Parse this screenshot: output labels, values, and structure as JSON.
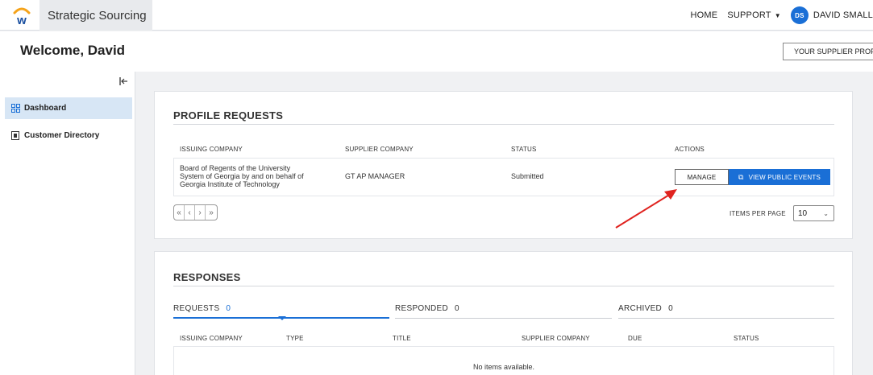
{
  "header": {
    "app_title": "Strategic Sourcing",
    "nav": {
      "home": "HOME",
      "support": "SUPPORT",
      "user_initials": "DS",
      "user_name": "DAVID SMALL"
    },
    "brand_color": "#1a6fd6",
    "logo_letter": "w"
  },
  "welcome": {
    "title": "Welcome, David",
    "supplier_profile_button": "YOUR SUPPLIER PROFILE"
  },
  "sidebar": {
    "collapse_icon": "collapse-left-icon",
    "items": [
      {
        "label": "Dashboard",
        "icon": "dashboard-icon",
        "active": true
      },
      {
        "label": "Customer Directory",
        "icon": "directory-icon",
        "active": false
      }
    ]
  },
  "profile_requests": {
    "title": "PROFILE REQUESTS",
    "columns": [
      "ISSUING COMPANY",
      "SUPPLIER COMPANY",
      "STATUS",
      "ACTIONS"
    ],
    "rows": [
      {
        "issuing_company_lines": [
          "Board of Regents of the University",
          "System of Georgia by and on behalf of",
          "Georgia Institute of Technology"
        ],
        "supplier_company": "GT AP MANAGER",
        "status": "Submitted",
        "actions": {
          "manage": "MANAGE",
          "view_public_events": "VIEW PUBLIC EVENTS"
        }
      }
    ],
    "pagination": {
      "first": "«",
      "prev": "‹",
      "next": "›",
      "last": "»"
    },
    "items_per_page_label": "ITEMS PER PAGE",
    "items_per_page_value": "10"
  },
  "responses": {
    "title": "RESPONSES",
    "tabs": [
      {
        "label": "REQUESTS",
        "count": "0",
        "active": true
      },
      {
        "label": "RESPONDED",
        "count": "0",
        "active": false
      },
      {
        "label": "ARCHIVED",
        "count": "0",
        "active": false
      }
    ],
    "columns": [
      "ISSUING COMPANY",
      "TYPE",
      "TITLE",
      "SUPPLIER COMPANY",
      "DUE",
      "STATUS"
    ],
    "empty_message": "No items available."
  },
  "annotation": {
    "arrow_color": "#e0231f"
  }
}
